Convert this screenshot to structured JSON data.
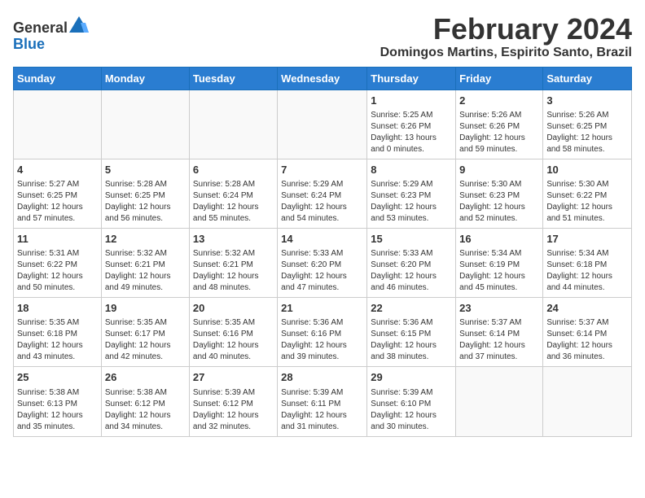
{
  "header": {
    "logo_line1": "General",
    "logo_line2": "Blue",
    "month_title": "February 2024",
    "subtitle": "Domingos Martins, Espirito Santo, Brazil"
  },
  "days_of_week": [
    "Sunday",
    "Monday",
    "Tuesday",
    "Wednesday",
    "Thursday",
    "Friday",
    "Saturday"
  ],
  "weeks": [
    [
      {
        "day": "",
        "info": ""
      },
      {
        "day": "",
        "info": ""
      },
      {
        "day": "",
        "info": ""
      },
      {
        "day": "",
        "info": ""
      },
      {
        "day": "1",
        "info": "Sunrise: 5:25 AM\nSunset: 6:26 PM\nDaylight: 13 hours\nand 0 minutes."
      },
      {
        "day": "2",
        "info": "Sunrise: 5:26 AM\nSunset: 6:26 PM\nDaylight: 12 hours\nand 59 minutes."
      },
      {
        "day": "3",
        "info": "Sunrise: 5:26 AM\nSunset: 6:25 PM\nDaylight: 12 hours\nand 58 minutes."
      }
    ],
    [
      {
        "day": "4",
        "info": "Sunrise: 5:27 AM\nSunset: 6:25 PM\nDaylight: 12 hours\nand 57 minutes."
      },
      {
        "day": "5",
        "info": "Sunrise: 5:28 AM\nSunset: 6:25 PM\nDaylight: 12 hours\nand 56 minutes."
      },
      {
        "day": "6",
        "info": "Sunrise: 5:28 AM\nSunset: 6:24 PM\nDaylight: 12 hours\nand 55 minutes."
      },
      {
        "day": "7",
        "info": "Sunrise: 5:29 AM\nSunset: 6:24 PM\nDaylight: 12 hours\nand 54 minutes."
      },
      {
        "day": "8",
        "info": "Sunrise: 5:29 AM\nSunset: 6:23 PM\nDaylight: 12 hours\nand 53 minutes."
      },
      {
        "day": "9",
        "info": "Sunrise: 5:30 AM\nSunset: 6:23 PM\nDaylight: 12 hours\nand 52 minutes."
      },
      {
        "day": "10",
        "info": "Sunrise: 5:30 AM\nSunset: 6:22 PM\nDaylight: 12 hours\nand 51 minutes."
      }
    ],
    [
      {
        "day": "11",
        "info": "Sunrise: 5:31 AM\nSunset: 6:22 PM\nDaylight: 12 hours\nand 50 minutes."
      },
      {
        "day": "12",
        "info": "Sunrise: 5:32 AM\nSunset: 6:21 PM\nDaylight: 12 hours\nand 49 minutes."
      },
      {
        "day": "13",
        "info": "Sunrise: 5:32 AM\nSunset: 6:21 PM\nDaylight: 12 hours\nand 48 minutes."
      },
      {
        "day": "14",
        "info": "Sunrise: 5:33 AM\nSunset: 6:20 PM\nDaylight: 12 hours\nand 47 minutes."
      },
      {
        "day": "15",
        "info": "Sunrise: 5:33 AM\nSunset: 6:20 PM\nDaylight: 12 hours\nand 46 minutes."
      },
      {
        "day": "16",
        "info": "Sunrise: 5:34 AM\nSunset: 6:19 PM\nDaylight: 12 hours\nand 45 minutes."
      },
      {
        "day": "17",
        "info": "Sunrise: 5:34 AM\nSunset: 6:18 PM\nDaylight: 12 hours\nand 44 minutes."
      }
    ],
    [
      {
        "day": "18",
        "info": "Sunrise: 5:35 AM\nSunset: 6:18 PM\nDaylight: 12 hours\nand 43 minutes."
      },
      {
        "day": "19",
        "info": "Sunrise: 5:35 AM\nSunset: 6:17 PM\nDaylight: 12 hours\nand 42 minutes."
      },
      {
        "day": "20",
        "info": "Sunrise: 5:35 AM\nSunset: 6:16 PM\nDaylight: 12 hours\nand 40 minutes."
      },
      {
        "day": "21",
        "info": "Sunrise: 5:36 AM\nSunset: 6:16 PM\nDaylight: 12 hours\nand 39 minutes."
      },
      {
        "day": "22",
        "info": "Sunrise: 5:36 AM\nSunset: 6:15 PM\nDaylight: 12 hours\nand 38 minutes."
      },
      {
        "day": "23",
        "info": "Sunrise: 5:37 AM\nSunset: 6:14 PM\nDaylight: 12 hours\nand 37 minutes."
      },
      {
        "day": "24",
        "info": "Sunrise: 5:37 AM\nSunset: 6:14 PM\nDaylight: 12 hours\nand 36 minutes."
      }
    ],
    [
      {
        "day": "25",
        "info": "Sunrise: 5:38 AM\nSunset: 6:13 PM\nDaylight: 12 hours\nand 35 minutes."
      },
      {
        "day": "26",
        "info": "Sunrise: 5:38 AM\nSunset: 6:12 PM\nDaylight: 12 hours\nand 34 minutes."
      },
      {
        "day": "27",
        "info": "Sunrise: 5:39 AM\nSunset: 6:12 PM\nDaylight: 12 hours\nand 32 minutes."
      },
      {
        "day": "28",
        "info": "Sunrise: 5:39 AM\nSunset: 6:11 PM\nDaylight: 12 hours\nand 31 minutes."
      },
      {
        "day": "29",
        "info": "Sunrise: 5:39 AM\nSunset: 6:10 PM\nDaylight: 12 hours\nand 30 minutes."
      },
      {
        "day": "",
        "info": ""
      },
      {
        "day": "",
        "info": ""
      }
    ]
  ]
}
